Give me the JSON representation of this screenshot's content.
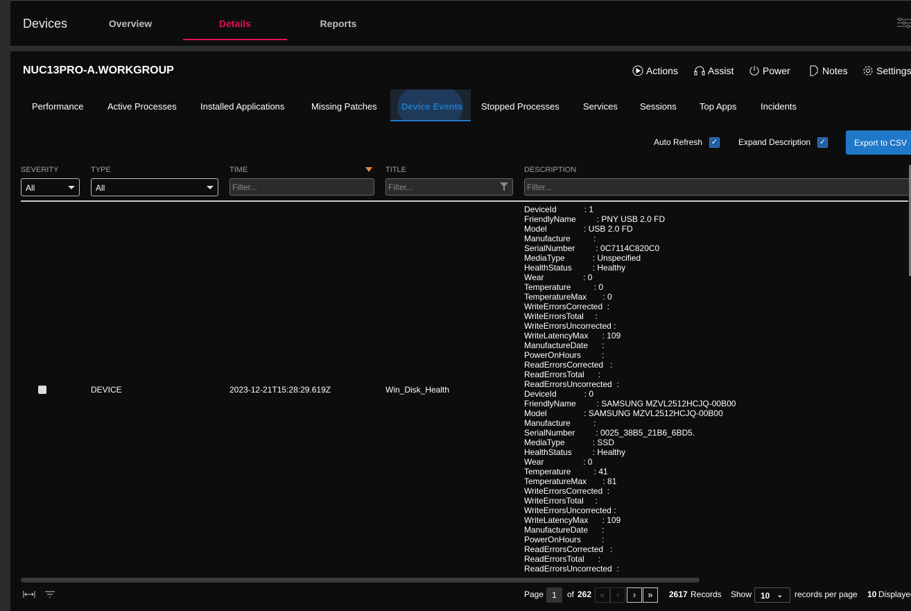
{
  "app": {
    "title": "Devices",
    "nav": [
      {
        "label": "Overview"
      },
      {
        "label": "Details",
        "active": true
      },
      {
        "label": "Reports"
      }
    ]
  },
  "device": {
    "name": "NUC13PRO-A.WORKGROUP"
  },
  "actions": [
    {
      "label": "Actions",
      "icon": "play-circle-icon"
    },
    {
      "label": "Assist",
      "icon": "headset-icon"
    },
    {
      "label": "Power",
      "icon": "power-icon"
    },
    {
      "label": "Notes",
      "icon": "notes-icon"
    },
    {
      "label": "Settings",
      "icon": "gear-icon"
    }
  ],
  "subtabs": [
    "Performance",
    "Active Processes",
    "Installed Applications",
    "Missing Patches",
    "Device Events",
    "Stopped Processes",
    "Services",
    "Sessions",
    "Top Apps",
    "Incidents"
  ],
  "active_subtab": "Device Events",
  "options": {
    "auto_refresh": "Auto Refresh",
    "auto_refresh_checked": true,
    "expand_description": "Expand Description",
    "expand_description_checked": true,
    "export": "Export to CSV"
  },
  "colors": {
    "accent": "#e0114f",
    "primary": "#1f78c8",
    "sort": "#e8893a"
  },
  "table": {
    "columns": {
      "severity": "SEVERITY",
      "type": "TYPE",
      "time": "TIME",
      "title": "TITLE",
      "description": "DESCRIPTION"
    },
    "filters": {
      "severity": "All",
      "type": "All",
      "placeholder": "Filter..."
    },
    "sort": {
      "column": "TIME",
      "direction": "descending"
    },
    "rows": [
      {
        "type": "DEVICE",
        "time": "2023-12-21T15:28:29.619Z",
        "title": "Win_Disk_Health",
        "description": "DeviceId            : 1\nFriendlyName         : PNY USB 2.0 FD\nModel                : USB 2.0 FD\nManufacture          :\nSerialNumber         : 0C7114C820C0\nMediaType            : Unspecified\nHealthStatus         : Healthy\nWear                 : 0\nTemperature          : 0\nTemperatureMax       : 0\nWriteErrorsCorrected  :\nWriteErrorsTotal     :\nWriteErrorsUncorrected :\nWriteLatencyMax      : 109\nManufactureDate      :\nPowerOnHours         :\nReadErrorsCorrected   :\nReadErrorsTotal      :\nReadErrorsUncorrected  :\nDeviceId            : 0\nFriendlyName         : SAMSUNG MZVL2512HCJQ-00B00\nModel                : SAMSUNG MZVL2512HCJQ-00B00\nManufacture          :\nSerialNumber         : 0025_38B5_21B6_6BD5.\nMediaType            : SSD\nHealthStatus         : Healthy\nWear                 : 0\nTemperature          : 41\nTemperatureMax       : 81\nWriteErrorsCorrected  :\nWriteErrorsTotal     :\nWriteErrorsUncorrected :\nWriteLatencyMax      : 109\nManufactureDate      :\nPowerOnHours         :\nReadErrorsCorrected   :\nReadErrorsTotal      :\nReadErrorsUncorrected  :"
      }
    ]
  },
  "pagination": {
    "page_label": "Page",
    "page": "1",
    "of_label": "of",
    "total_pages": "262",
    "records": "2617",
    "records_label": "Records",
    "show_label": "Show",
    "per_page": "10",
    "per_page_label": "records per page",
    "displayed": "10",
    "displayed_label": "Displayed"
  }
}
